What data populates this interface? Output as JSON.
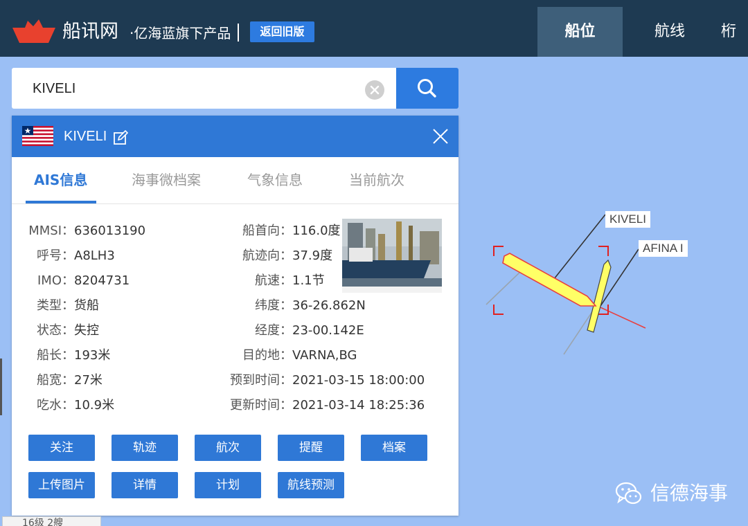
{
  "header": {
    "brand": "船讯网",
    "brand_sub": "·亿海蓝旗下产品",
    "old_version": "返回旧版",
    "nav": [
      "船位",
      "航线",
      "桁"
    ]
  },
  "search": {
    "value": "KIVELI",
    "placeholder": ""
  },
  "ship": {
    "name": "KIVELI",
    "tabs": [
      "AIS信息",
      "海事微档案",
      "气象信息",
      "当前航次"
    ],
    "left_fields": [
      {
        "label": "MMSI：",
        "value": "636013190"
      },
      {
        "label": "呼号：",
        "value": "A8LH3"
      },
      {
        "label": "IMO：",
        "value": "8204731"
      },
      {
        "label": "类型：",
        "value": "货船"
      },
      {
        "label": "状态：",
        "value": "失控"
      },
      {
        "label": "船长：",
        "value": "193米"
      },
      {
        "label": "船宽：",
        "value": "27米"
      },
      {
        "label": "吃水：",
        "value": "10.9米"
      }
    ],
    "right_fields": [
      {
        "label": "船首向：",
        "value": "116.0度"
      },
      {
        "label": "航迹向：",
        "value": "37.9度"
      },
      {
        "label": "航速：",
        "value": "1.1节"
      },
      {
        "label": "纬度：",
        "value": "36-26.862N"
      },
      {
        "label": "经度：",
        "value": "23-00.142E"
      },
      {
        "label": "目的地：",
        "value": "VARNA,BG"
      },
      {
        "label": "预到时间：",
        "value": "2021-03-15 18:00:00"
      },
      {
        "label": "更新时间：",
        "value": "2021-03-14 18:25:36"
      }
    ],
    "actions": [
      "关注",
      "轨迹",
      "航次",
      "提醒",
      "档案",
      "上传图片",
      "详情",
      "计划",
      "航线预测"
    ]
  },
  "map": {
    "labels": [
      "KIVELI",
      "AFINA I"
    ],
    "zoom_status": "16级 2艘",
    "watermark": "信德海事"
  },
  "colors": {
    "header": "#1e3a52",
    "accent": "#2f78d6",
    "map_bg": "#9bbff5",
    "ship_fill": "#ffff66",
    "heading_line": "#e84040"
  }
}
